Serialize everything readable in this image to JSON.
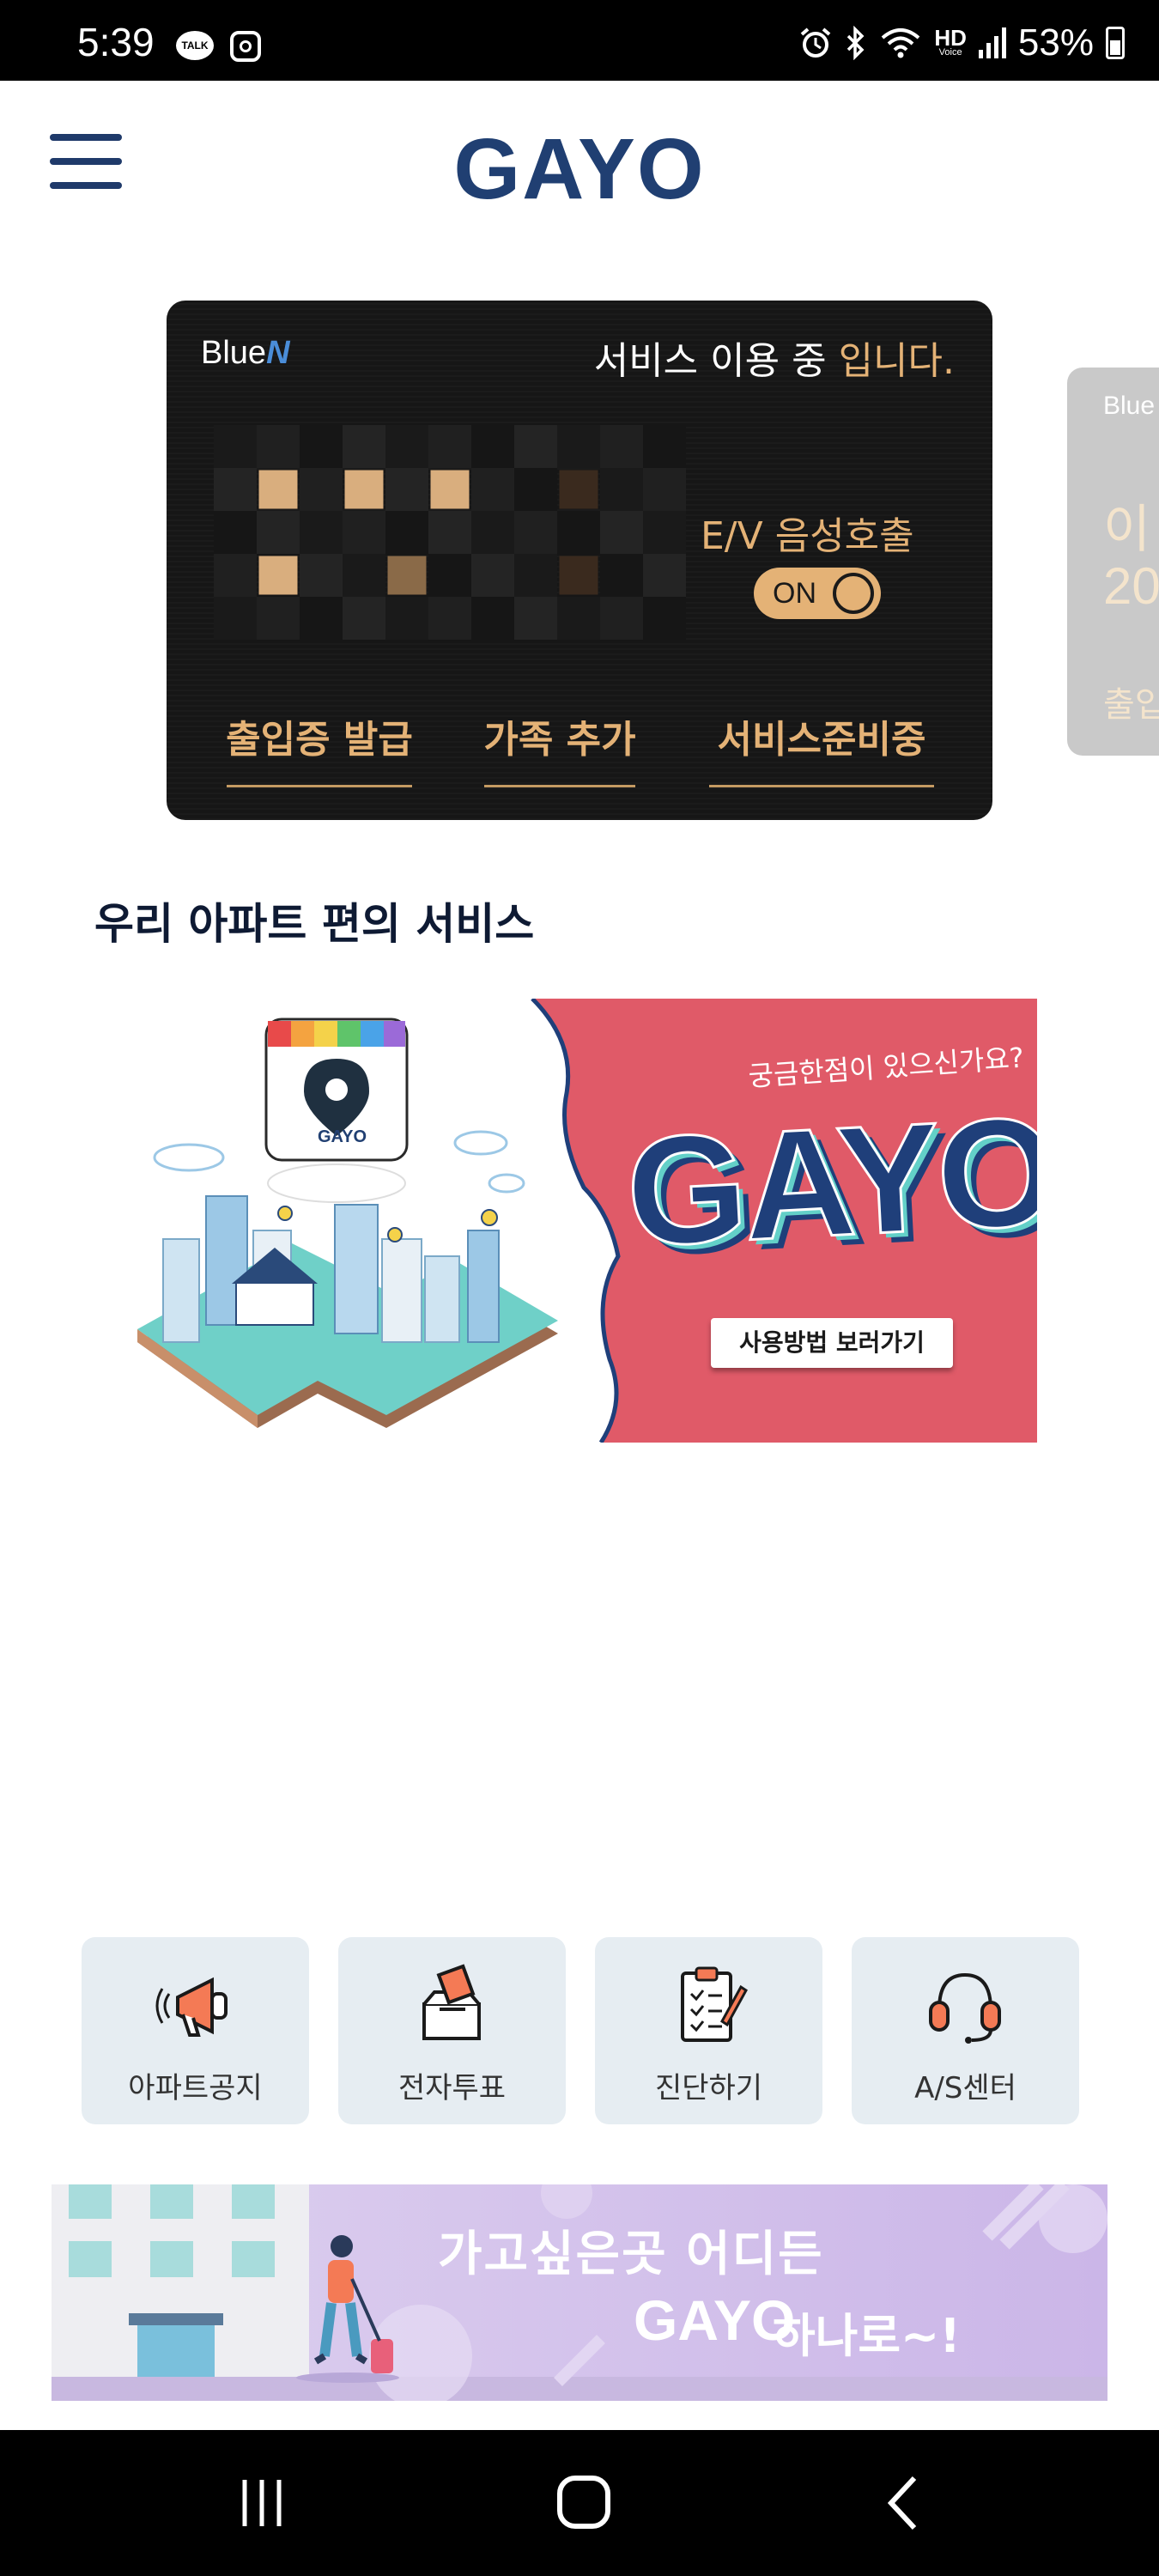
{
  "status_bar": {
    "time": "5:39",
    "kakao_label": "TALK",
    "hd_label": "HD",
    "volte_label": "Voice",
    "battery": "53%"
  },
  "header": {
    "title": "GAYO",
    "menu_icon": "hamburger-menu-icon"
  },
  "service_card": {
    "logo_text": "Blue",
    "logo_mark": "N",
    "status_prefix": "서비스 이용 중 ",
    "status_highlight": "입니다.",
    "ev_label": "E/V 음성호출",
    "ev_toggle": "ON",
    "actions": [
      "출입증 발급",
      "가족 추가",
      "서비스준비중"
    ],
    "accent_color": "#e4b276"
  },
  "peek_card": {
    "logo_text": "Blue",
    "line1": "이",
    "line2": "20",
    "line3": "출입"
  },
  "section": {
    "title": "우리 아파트 편의 서비스"
  },
  "banner": {
    "question": "궁금한점이 있으신가요?",
    "brand": "GAYO",
    "button": "사용방법 보러가기",
    "app_icon_label": "GAYO",
    "bg_color": "#e05a68"
  },
  "quick_menu": [
    {
      "label": "아파트공지",
      "icon": "megaphone-icon"
    },
    {
      "label": "전자투표",
      "icon": "ballot-box-icon"
    },
    {
      "label": "진단하기",
      "icon": "clipboard-checklist-icon"
    },
    {
      "label": "A/S센터",
      "icon": "headset-icon"
    }
  ],
  "promo": {
    "line1": "가고싶은곳 어디든",
    "brand": "GAYO",
    "line2": "하나로~!"
  },
  "nav": {
    "recent": "recent-apps-icon",
    "home": "home-icon",
    "back": "back-icon"
  }
}
